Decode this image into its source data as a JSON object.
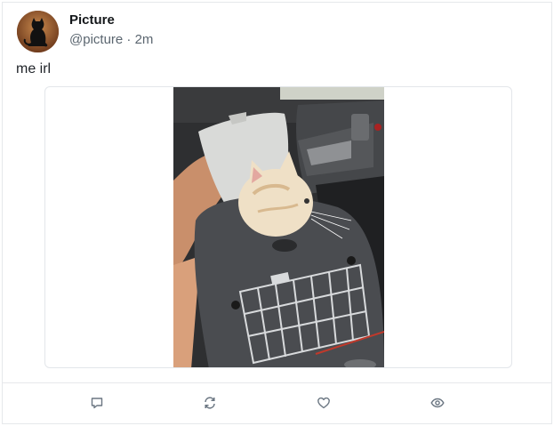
{
  "post": {
    "author_name": "Picture",
    "handle": "@picture",
    "separator": " · ",
    "time": "2m",
    "text": "me irl"
  },
  "media": {
    "description_icon": "photo-of-cat-in-pet-carrier"
  },
  "actions": [
    {
      "icon": "reply-icon"
    },
    {
      "icon": "boost-icon"
    },
    {
      "icon": "favourite-icon"
    },
    {
      "icon": "view-icon"
    }
  ],
  "colors": {
    "text": "#14171a",
    "muted": "#5b6670",
    "border": "#e6e8eb",
    "icon": "#6b7682"
  }
}
